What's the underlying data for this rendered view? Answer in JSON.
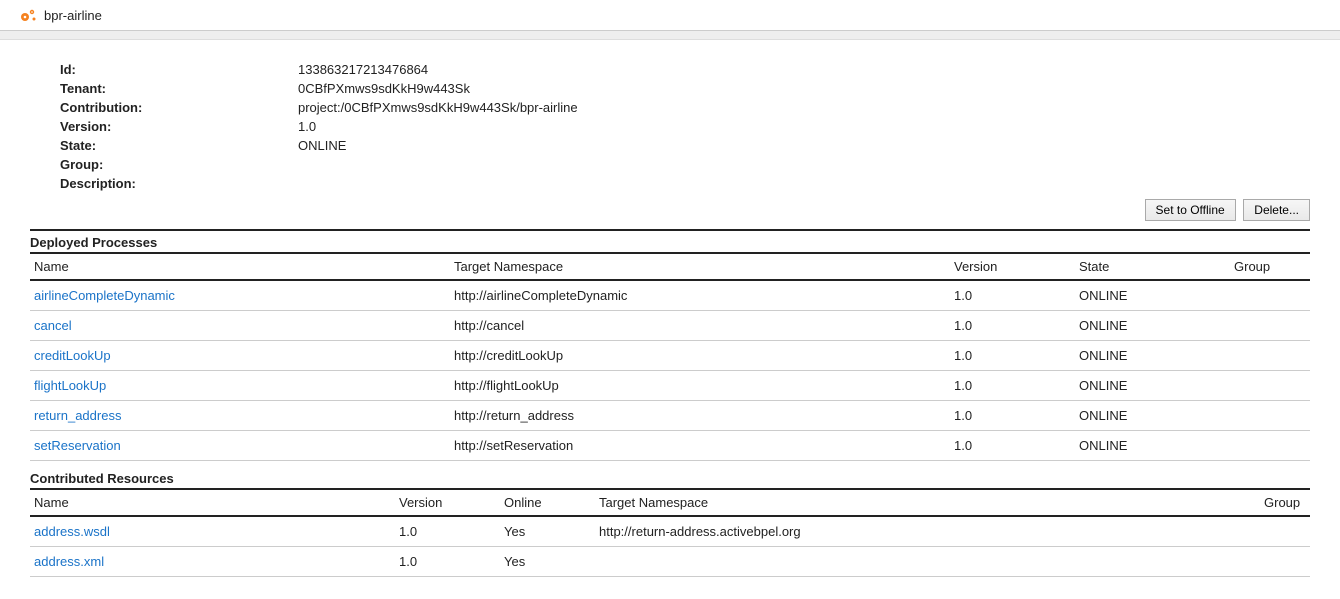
{
  "header": {
    "title": "bpr-airline"
  },
  "details": {
    "labels": {
      "id": "Id:",
      "tenant": "Tenant:",
      "contribution": "Contribution:",
      "version": "Version:",
      "state": "State:",
      "group": "Group:",
      "description": "Description:"
    },
    "values": {
      "id": "133863217213476864",
      "tenant": "0CBfPXmws9sdKkH9w443Sk",
      "contribution": "project:/0CBfPXmws9sdKkH9w443Sk/bpr-airline",
      "version": "1.0",
      "state": "ONLINE",
      "group": "",
      "description": ""
    }
  },
  "actions": {
    "set_offline": "Set to Offline",
    "delete": "Delete..."
  },
  "deployed_processes": {
    "title": "Deployed Processes",
    "columns": {
      "name": "Name",
      "target_ns": "Target Namespace",
      "version": "Version",
      "state": "State",
      "group": "Group"
    },
    "rows": [
      {
        "name": "airlineCompleteDynamic",
        "target_ns": "http://airlineCompleteDynamic",
        "version": "1.0",
        "state": "ONLINE",
        "group": ""
      },
      {
        "name": "cancel",
        "target_ns": "http://cancel",
        "version": "1.0",
        "state": "ONLINE",
        "group": ""
      },
      {
        "name": "creditLookUp",
        "target_ns": "http://creditLookUp",
        "version": "1.0",
        "state": "ONLINE",
        "group": ""
      },
      {
        "name": "flightLookUp",
        "target_ns": "http://flightLookUp",
        "version": "1.0",
        "state": "ONLINE",
        "group": ""
      },
      {
        "name": "return_address",
        "target_ns": "http://return_address",
        "version": "1.0",
        "state": "ONLINE",
        "group": ""
      },
      {
        "name": "setReservation",
        "target_ns": "http://setReservation",
        "version": "1.0",
        "state": "ONLINE",
        "group": ""
      }
    ]
  },
  "contributed_resources": {
    "title": "Contributed Resources",
    "columns": {
      "name": "Name",
      "version": "Version",
      "online": "Online",
      "target_ns": "Target Namespace",
      "group": "Group"
    },
    "rows": [
      {
        "name": "address.wsdl",
        "version": "1.0",
        "online": "Yes",
        "target_ns": "http://return-address.activebpel.org",
        "group": ""
      },
      {
        "name": "address.xml",
        "version": "1.0",
        "online": "Yes",
        "target_ns": "",
        "group": ""
      }
    ]
  }
}
